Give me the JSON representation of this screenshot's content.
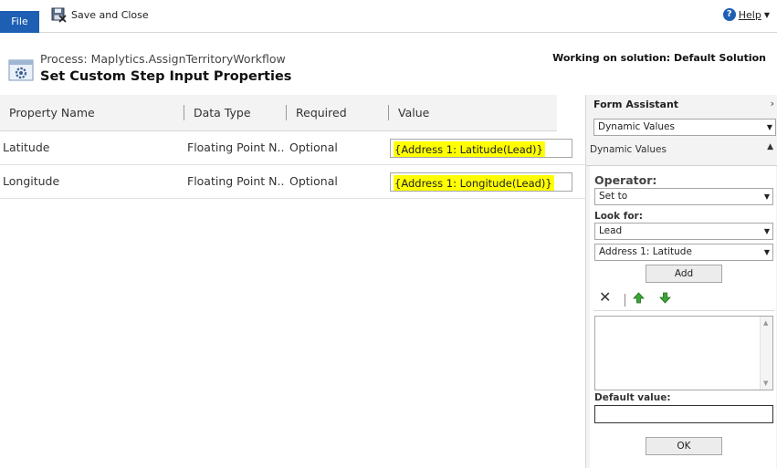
{
  "ribbon": {
    "file_label": "File",
    "save_close_label": "Save and Close",
    "help_label": "Help"
  },
  "header": {
    "process_title": "Process: Maplytics.AssignTerritoryWorkflow",
    "page_title": "Set Custom Step Input Properties",
    "solution_text": "Working on solution: Default Solution"
  },
  "grid": {
    "columns": [
      "Property Name",
      "Data Type",
      "Required",
      "Value"
    ],
    "rows": [
      {
        "name": "Latitude",
        "type": "Floating Point N...",
        "required": "Optional",
        "value": "{Address 1: Latitude(Lead)}"
      },
      {
        "name": "Longitude",
        "type": "Floating Point N...",
        "required": "Optional",
        "value": "{Address 1: Longitude(Lead)}"
      }
    ]
  },
  "form_assistant": {
    "title": "Form Assistant",
    "mode_select": "Dynamic Values",
    "section_label": "Dynamic Values",
    "operator_label": "Operator:",
    "operator_value": "Set to",
    "look_for_label": "Look for:",
    "entity_value": "Lead",
    "attribute_value": "Address 1: Latitude",
    "add_label": "Add",
    "default_value_label": "Default value:",
    "ok_label": "OK"
  },
  "colors": {
    "file_tab": "#1e5fb4",
    "highlight": "#ffff00",
    "arrow_green": "#3aa535"
  },
  "icons": {
    "save": "save-close-icon",
    "help": "help-icon",
    "process": "process-gear-icon",
    "delete": "delete-x-icon",
    "move_up": "arrow-up-icon",
    "move_down": "arrow-down-icon"
  }
}
